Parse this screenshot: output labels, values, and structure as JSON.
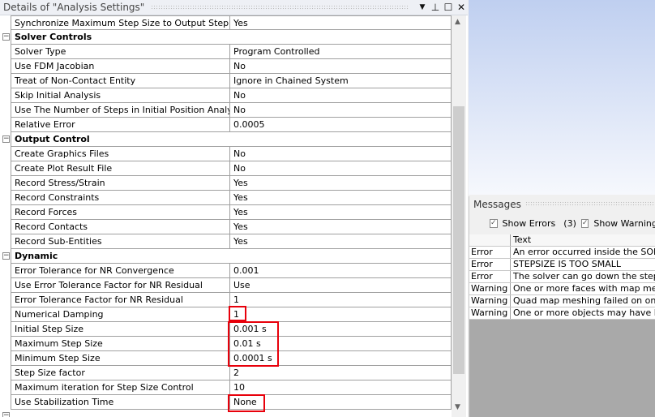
{
  "panel": {
    "title": "Details of \"Analysis Settings\"",
    "dropdown_icon": "▼",
    "pin_icon": "⊥",
    "max_icon": "☐",
    "close_icon": "✕"
  },
  "rows": [
    {
      "type": "item",
      "name": "Synchronize Maximum Step Size to Output Step",
      "value": "Yes"
    },
    {
      "type": "header",
      "name": "Solver Controls"
    },
    {
      "type": "item",
      "name": "Solver Type",
      "value": "Program Controlled"
    },
    {
      "type": "item",
      "name": "Use FDM Jacobian",
      "value": "No"
    },
    {
      "type": "item",
      "name": "Treat of Non-Contact Entity",
      "value": "Ignore in Chained System"
    },
    {
      "type": "item",
      "name": "Skip Initial Analysis",
      "value": "No"
    },
    {
      "type": "item",
      "name": "Use The Number of Steps in Initial Position Analysis",
      "value": "No"
    },
    {
      "type": "item",
      "name": "Relative Error",
      "value": "0.0005"
    },
    {
      "type": "header",
      "name": "Output Control"
    },
    {
      "type": "item",
      "name": "Create Graphics Files",
      "value": "No"
    },
    {
      "type": "item",
      "name": "Create Plot Result File",
      "value": "No"
    },
    {
      "type": "item",
      "name": "Record Stress/Strain",
      "value": "Yes"
    },
    {
      "type": "item",
      "name": "Record Constraints",
      "value": "Yes"
    },
    {
      "type": "item",
      "name": "Record Forces",
      "value": "Yes"
    },
    {
      "type": "item",
      "name": "Record Contacts",
      "value": "Yes"
    },
    {
      "type": "item",
      "name": "Record Sub-Entities",
      "value": "Yes"
    },
    {
      "type": "header",
      "name": "Dynamic"
    },
    {
      "type": "item",
      "name": "Error Tolerance for NR Convergence",
      "value": "0.001"
    },
    {
      "type": "item",
      "name": "Use Error Tolerance Factor for NR Residual",
      "value": "Use"
    },
    {
      "type": "item",
      "name": "Error Tolerance Factor for NR Residual",
      "value": "1"
    },
    {
      "type": "item",
      "name": "Numerical Damping",
      "value": "1"
    },
    {
      "type": "item",
      "name": "Initial Step Size",
      "value": "0.001 s"
    },
    {
      "type": "item",
      "name": "Maximum Step Size",
      "value": "0.01 s"
    },
    {
      "type": "item",
      "name": "Minimum Step Size",
      "value": "0.0001 s"
    },
    {
      "type": "item",
      "name": "Step Size factor",
      "value": "2"
    },
    {
      "type": "item",
      "name": "Maximum iteration for Step Size Control",
      "value": "10"
    },
    {
      "type": "item",
      "name": "Use Stabilization Time",
      "value": "None"
    }
  ],
  "messages": {
    "title": "Messages",
    "show_errors": "Show Errors",
    "error_count": "(3)",
    "show_warnings": "Show Warning",
    "col_text": "Text",
    "items": [
      {
        "type": "Error",
        "text": "An error occurred inside the SOLVER"
      },
      {
        "type": "Error",
        "text": " STEPSIZE IS TOO SMALL"
      },
      {
        "type": "Error",
        "text": "The solver can go down the step size"
      },
      {
        "type": "Warning",
        "text": "One or more faces with map mesh"
      },
      {
        "type": "Warning",
        "text": "Quad map meshing failed on one or"
      },
      {
        "type": "Warning",
        "text": "One or more objects may have lost"
      }
    ]
  }
}
